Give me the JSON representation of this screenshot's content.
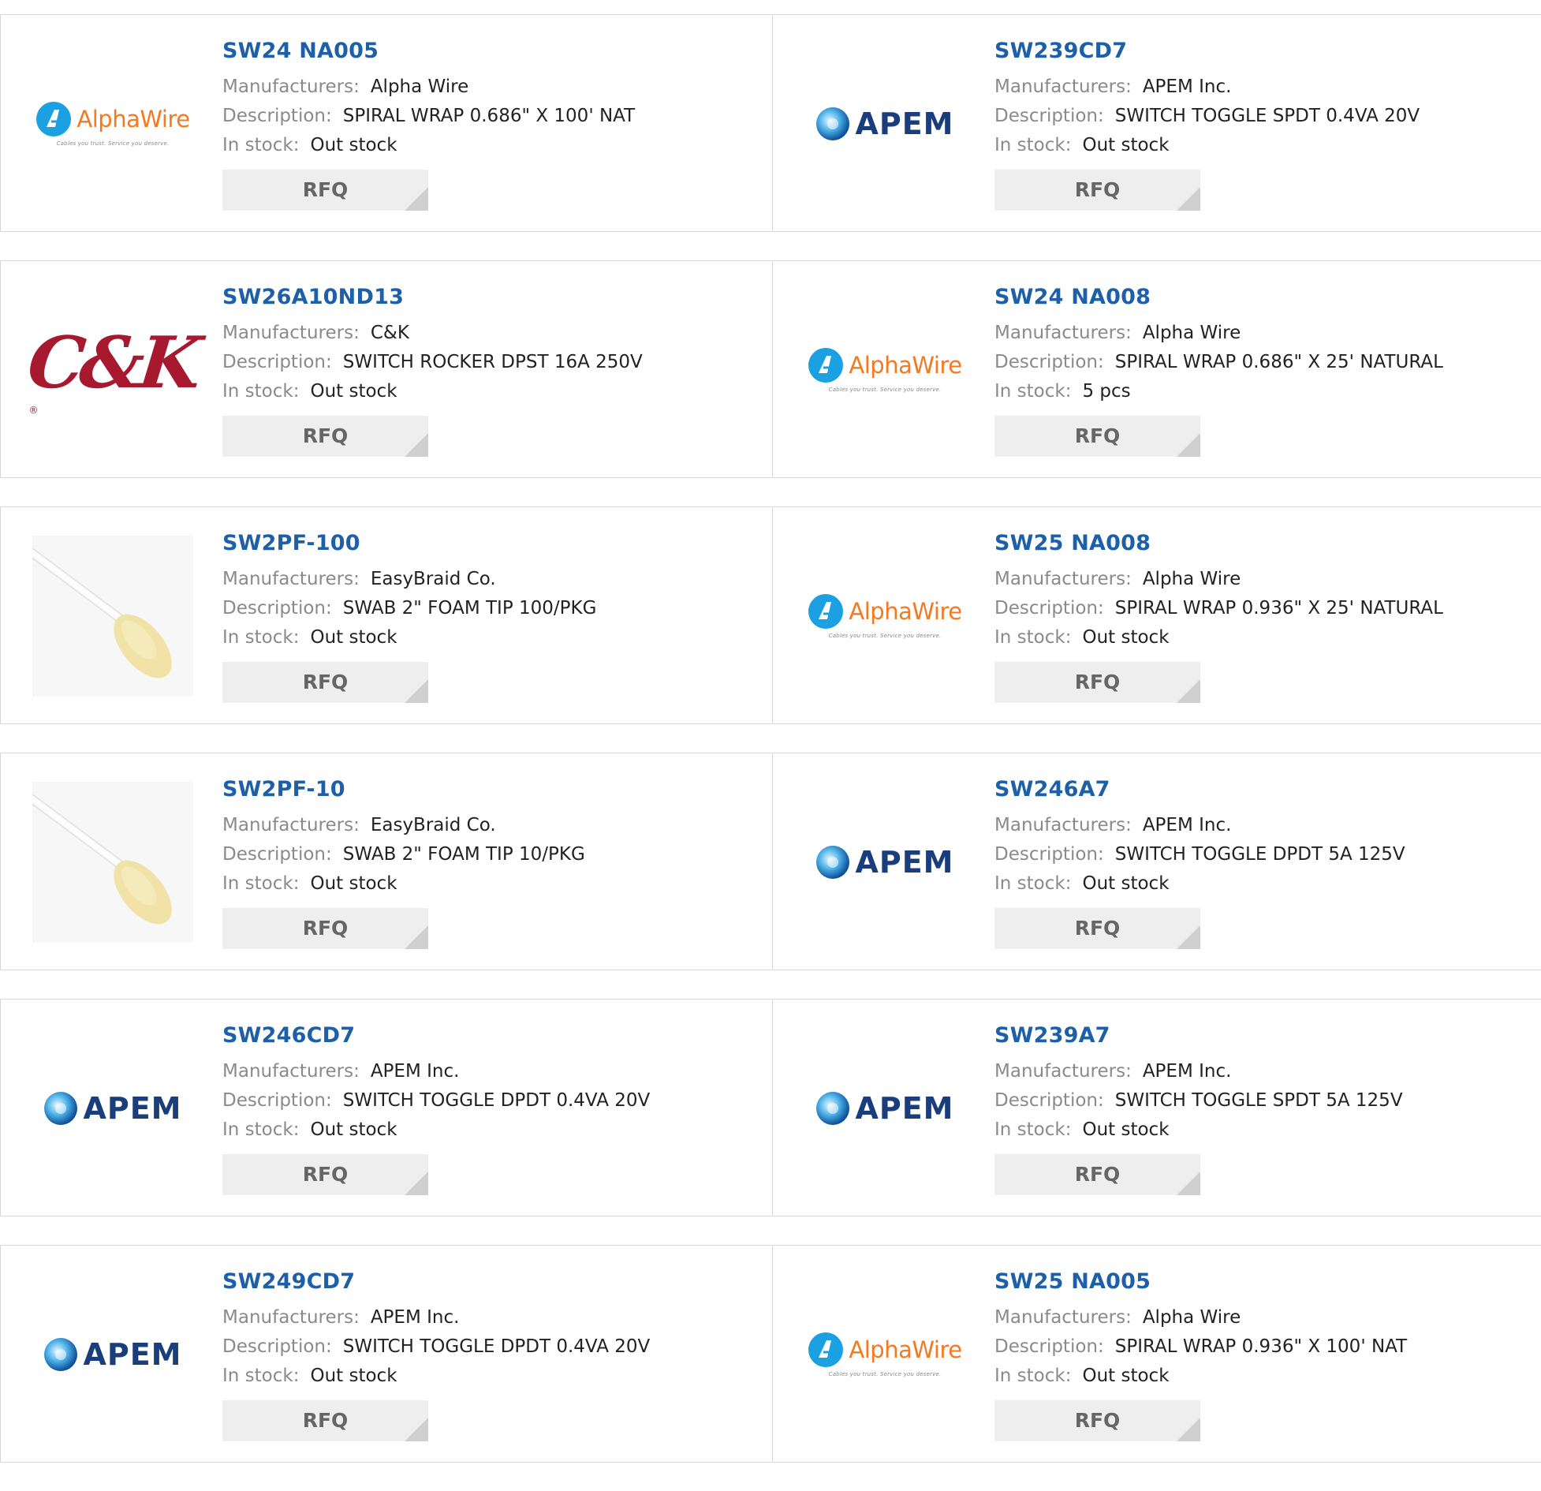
{
  "labels": {
    "manufacturers": "Manufacturers:",
    "description": "Description:",
    "in_stock": "In stock:",
    "rfq": "RFQ"
  },
  "products": [
    {
      "part": "SW24 NA005",
      "manufacturer": "Alpha Wire",
      "description": "SPIRAL WRAP 0.686\" X 100' NAT",
      "stock": "Out stock",
      "logo": "alphawire"
    },
    {
      "part": "SW239CD7",
      "manufacturer": "APEM Inc.",
      "description": "SWITCH TOGGLE SPDT 0.4VA 20V",
      "stock": "Out stock",
      "logo": "apem"
    },
    {
      "part": "SW26A10ND13",
      "manufacturer": "C&K",
      "description": "SWITCH ROCKER DPST 16A 250V",
      "stock": "Out stock",
      "logo": "ck"
    },
    {
      "part": "SW24 NA008",
      "manufacturer": "Alpha Wire",
      "description": "SPIRAL WRAP 0.686\" X 25' NATURAL",
      "stock": "5 pcs",
      "logo": "alphawire"
    },
    {
      "part": "SW2PF-100",
      "manufacturer": "EasyBraid Co.",
      "description": "SWAB 2\" FOAM TIP 100/PKG",
      "stock": "Out stock",
      "logo": "swab"
    },
    {
      "part": "SW25 NA008",
      "manufacturer": "Alpha Wire",
      "description": "SPIRAL WRAP 0.936\" X 25' NATURAL",
      "stock": "Out stock",
      "logo": "alphawire"
    },
    {
      "part": "SW2PF-10",
      "manufacturer": "EasyBraid Co.",
      "description": "SWAB 2\" FOAM TIP 10/PKG",
      "stock": "Out stock",
      "logo": "swab"
    },
    {
      "part": "SW246A7",
      "manufacturer": "APEM Inc.",
      "description": "SWITCH TOGGLE DPDT 5A 125V",
      "stock": "Out stock",
      "logo": "apem"
    },
    {
      "part": "SW246CD7",
      "manufacturer": "APEM Inc.",
      "description": "SWITCH TOGGLE DPDT 0.4VA 20V",
      "stock": "Out stock",
      "logo": "apem"
    },
    {
      "part": "SW239A7",
      "manufacturer": "APEM Inc.",
      "description": "SWITCH TOGGLE SPDT 5A 125V",
      "stock": "Out stock",
      "logo": "apem"
    },
    {
      "part": "SW249CD7",
      "manufacturer": "APEM Inc.",
      "description": "SWITCH TOGGLE DPDT 0.4VA 20V",
      "stock": "Out stock",
      "logo": "apem"
    },
    {
      "part": "SW25 NA005",
      "manufacturer": "Alpha Wire",
      "description": "SPIRAL WRAP 0.936\" X 100' NAT",
      "stock": "Out stock",
      "logo": "alphawire"
    }
  ],
  "logos": {
    "alphawire": {
      "word": "AlphaWire",
      "tagline": "Cables you trust. Service you deserve."
    },
    "apem": {
      "word": "APEM"
    },
    "ck": {
      "word": "C&K",
      "reg": "®"
    }
  },
  "colors": {
    "part_link": "#1d5fa8",
    "alphawire_orange": "#f47920",
    "alphawire_blue": "#1ba1e2",
    "apem_navy": "#1a3d7c",
    "ck_red": "#a6192e",
    "rfq_bg": "#eeeeee"
  }
}
